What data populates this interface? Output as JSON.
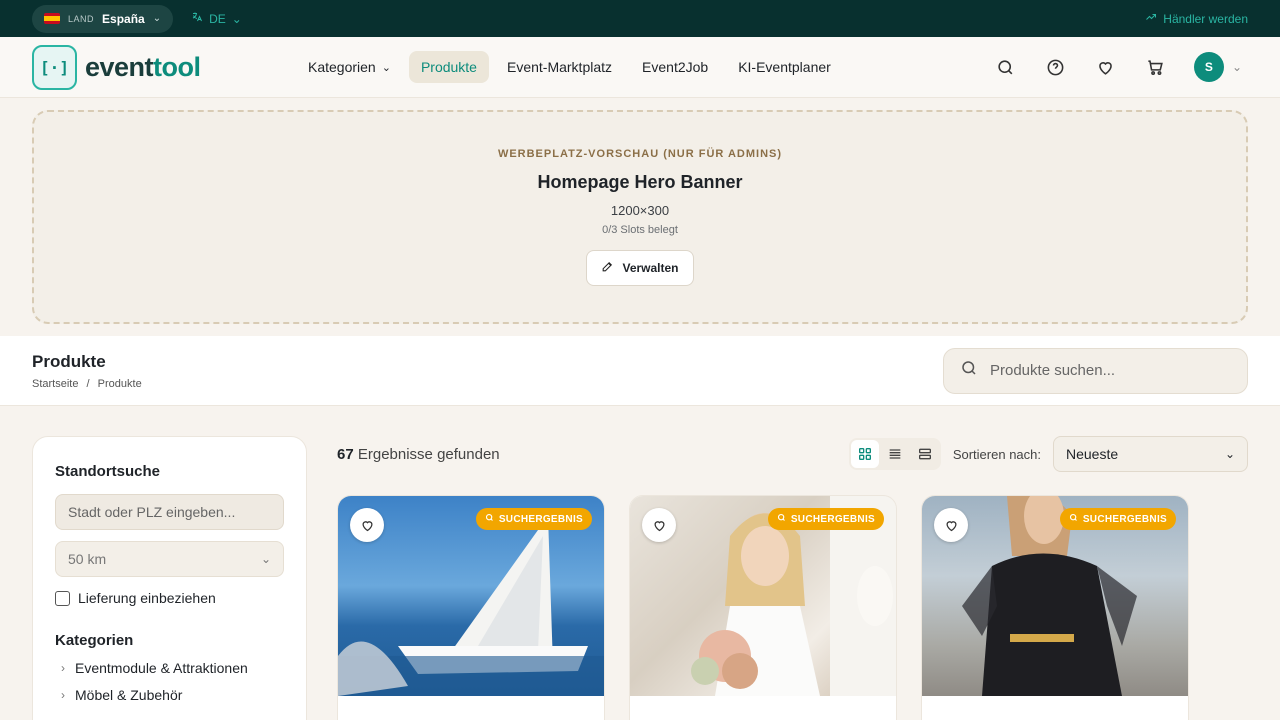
{
  "topbar": {
    "country_label": "LAND",
    "country_value": "España",
    "language": "DE",
    "dealer_link": "Händler werden"
  },
  "header": {
    "logo_text_a": "event",
    "logo_text_b": "tool",
    "nav": [
      {
        "label": "Kategorien"
      },
      {
        "label": "Produkte"
      },
      {
        "label": "Event-Marktplatz"
      },
      {
        "label": "Event2Job"
      },
      {
        "label": "KI-Eventplaner"
      }
    ],
    "avatar_initial": "S"
  },
  "ad_preview": {
    "eyebrow": "WERBEPLATZ-VORSCHAU (NUR FÜR ADMINS)",
    "title": "Homepage Hero Banner",
    "size": "1200×300",
    "slots": "0/3 Slots belegt",
    "manage_label": "Verwalten"
  },
  "page": {
    "title": "Produkte",
    "breadcrumb_home": "Startseite",
    "breadcrumb_sep": "/",
    "breadcrumb_current": "Produkte",
    "search_placeholder": "Produkte suchen..."
  },
  "sidebar": {
    "location_title": "Standortsuche",
    "location_placeholder": "Stadt oder PLZ eingeben...",
    "radius_value": "50 km",
    "delivery_label": "Lieferung einbeziehen",
    "categories_title": "Kategorien",
    "categories": [
      {
        "label": "Eventmodule & Attraktionen"
      },
      {
        "label": "Möbel & Zubehör"
      }
    ]
  },
  "results": {
    "count": "67",
    "text": "Ergebnisse gefunden",
    "sort_label": "Sortieren nach:",
    "sort_value": "Neueste"
  },
  "cards": [
    {
      "badge": "SUCHERGEBNIS"
    },
    {
      "badge": "SUCHERGEBNIS"
    },
    {
      "badge": "SUCHERGEBNIS"
    }
  ],
  "colors": {
    "topbar": "#08302f",
    "accent": "#0d8c7c",
    "badge": "#f2a600"
  }
}
